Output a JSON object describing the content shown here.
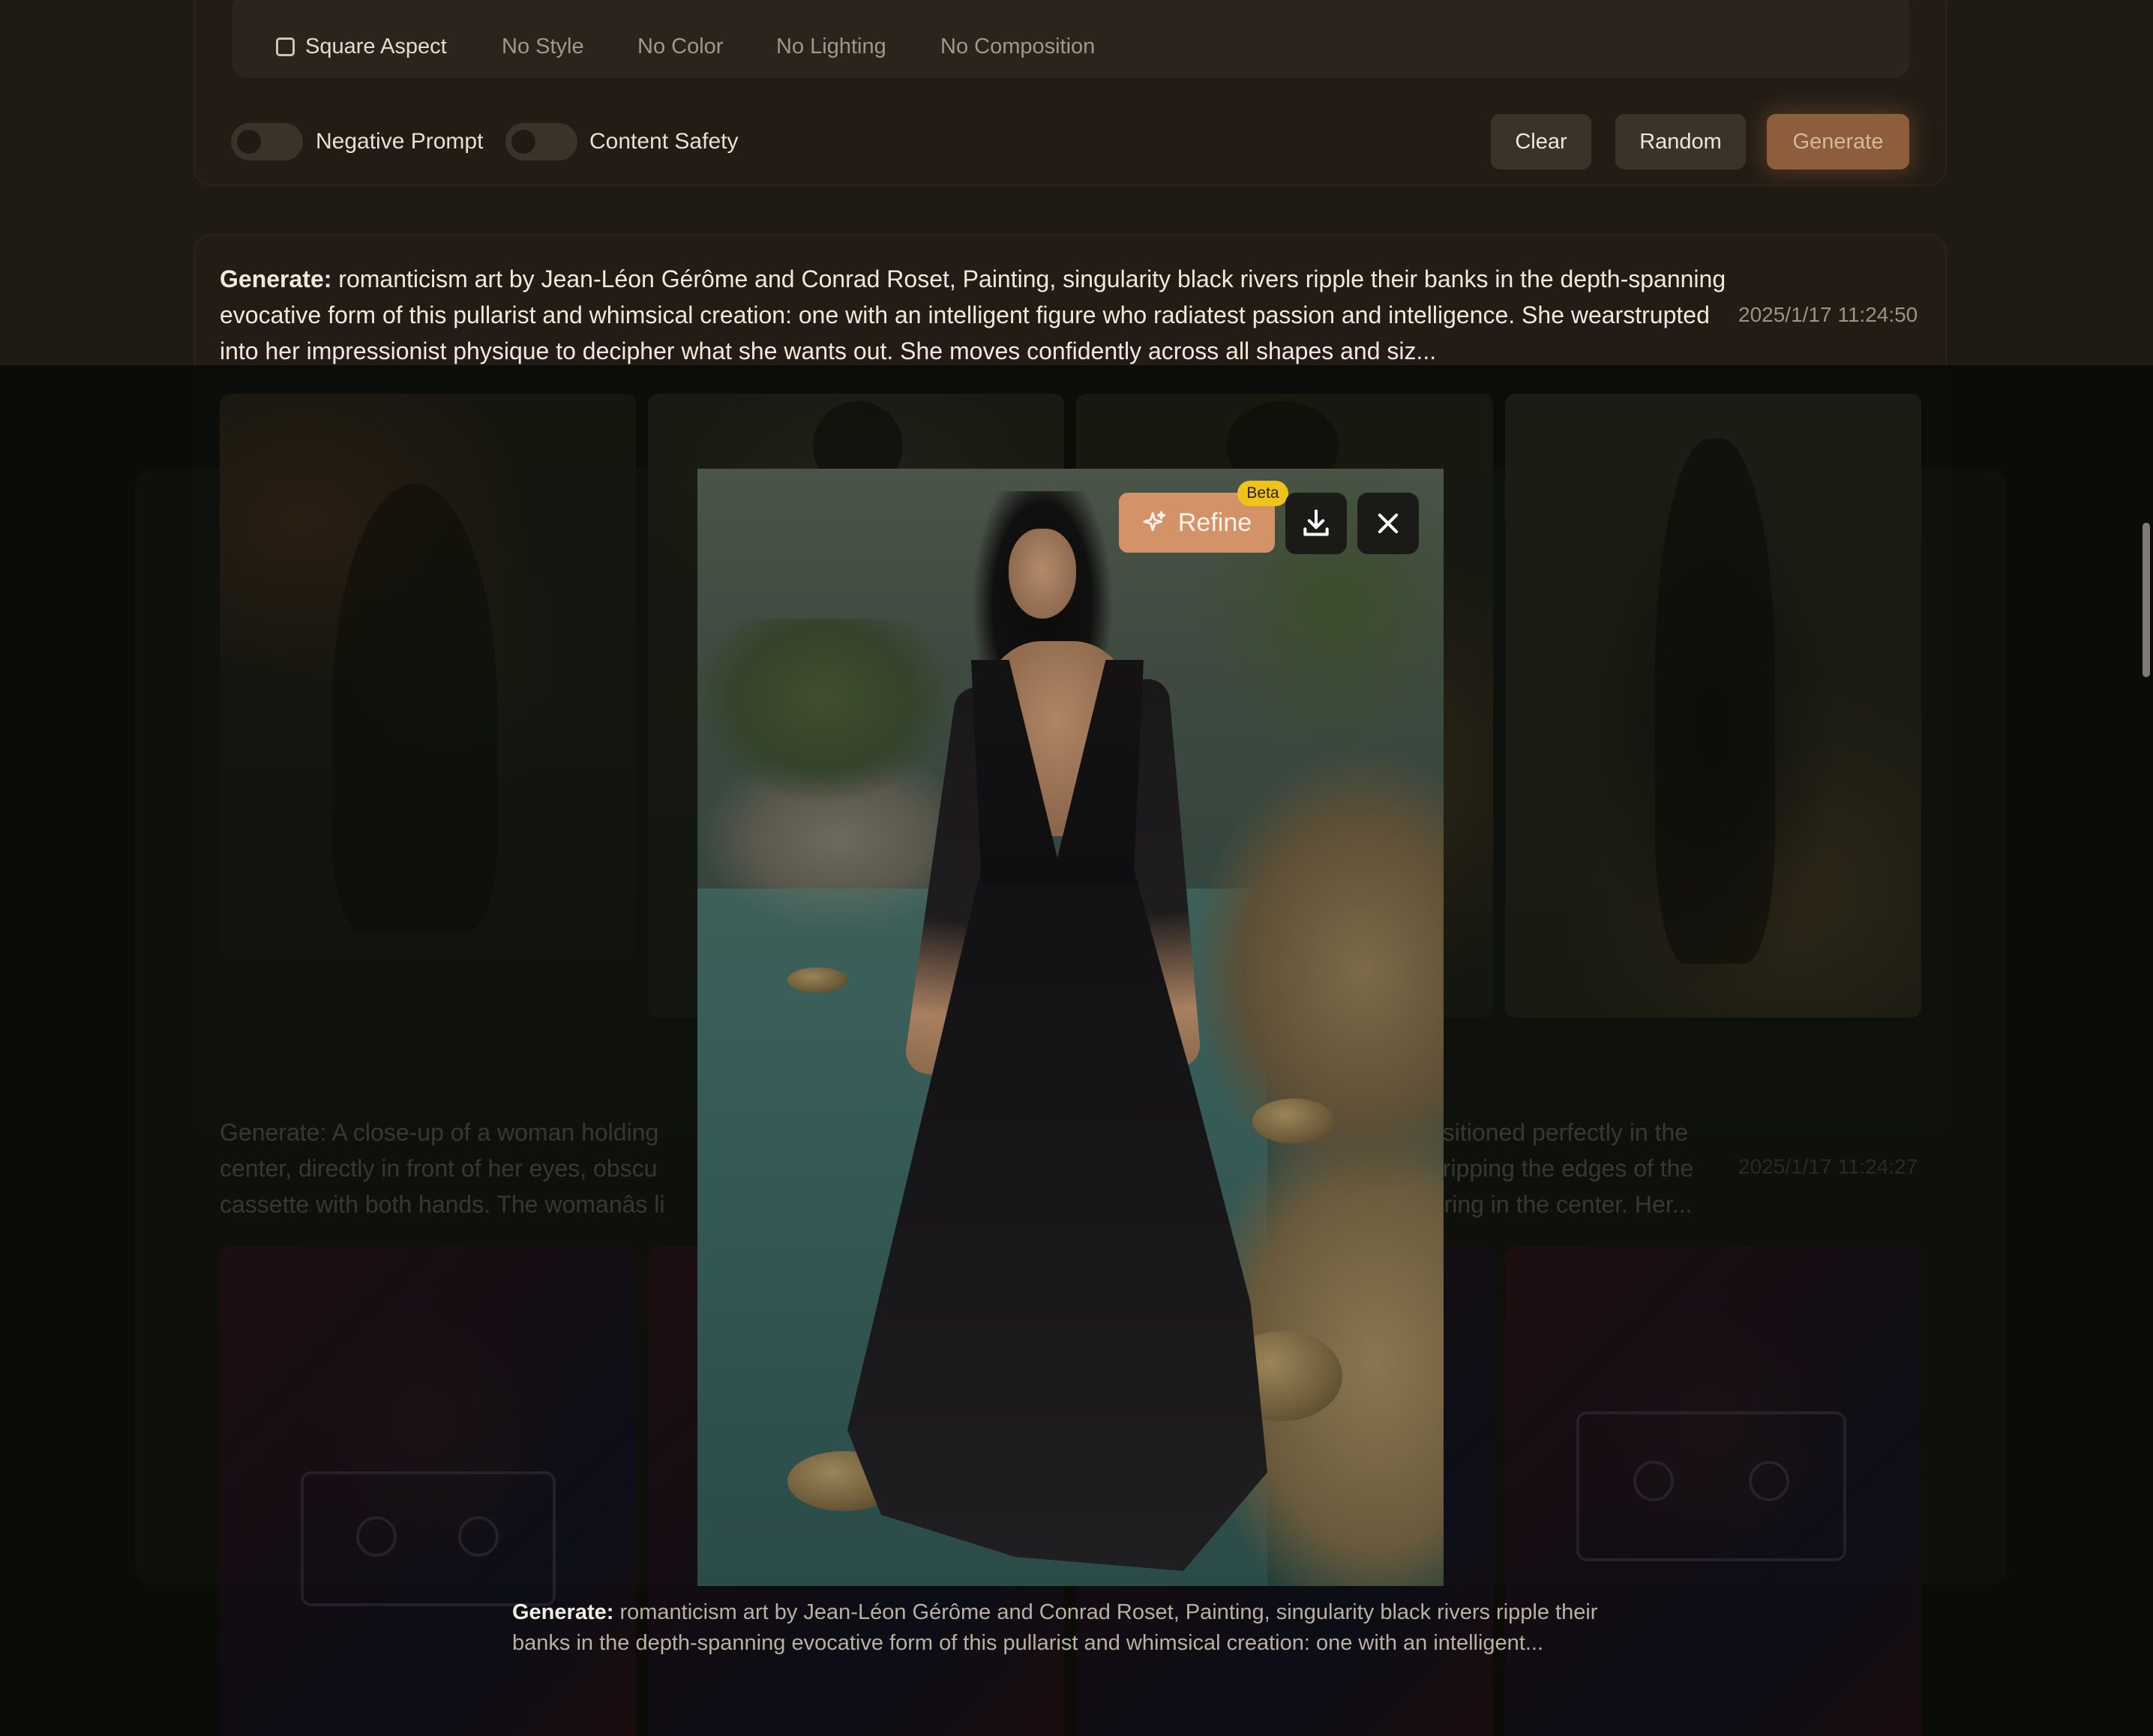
{
  "options_bar": {
    "square_aspect": "Square Aspect",
    "style": "No Style",
    "color": "No Color",
    "lighting": "No Lighting",
    "composition": "No Composition"
  },
  "toggles": {
    "negative_prompt": "Negative Prompt",
    "content_safety": "Content Safety"
  },
  "actions": {
    "clear": "Clear",
    "random": "Random",
    "generate": "Generate"
  },
  "history": [
    {
      "label": "Generate:",
      "prompt": "romanticism art by Jean-Léon Gérôme and Conrad Roset, Painting, singularity black rivers ripple their banks in the depth-spanning evocative form of this pullarist and whimsical creation: one with an intelligent figure who radiatest passion and intelligence. She wearstrupted into her impressionist physique to decipher what she wants out. She moves confidently across all shapes and siz...",
      "timestamp": "2025/1/17 11:24:50"
    },
    {
      "label": "Generate:",
      "prompt_parts": [
        "A close-up of a woman holding",
        "ositioned perfectly in the",
        "center, directly in front of her eyes, obscu",
        "gripping the edges of the",
        "cassette with both hands. The womanâs li",
        "r ring in the center. Her..."
      ],
      "timestamp": "2025/1/17 11:24:27"
    }
  ],
  "viewer": {
    "refine": "Refine",
    "badge": "Beta",
    "caption_label": "Generate:",
    "caption": "romanticism art by Jean-Léon Gérôme and Conrad Roset, Painting, singularity black rivers ripple their banks in the depth-spanning evocative form of this pullarist and whimsical creation: one with an intelligent..."
  },
  "icons": {
    "refine": "sparkle-icon",
    "download": "download-icon",
    "close": "close-icon"
  },
  "colors": {
    "accent": "#d49268",
    "badge": "#f0c21c",
    "background": "#1f1a13"
  }
}
